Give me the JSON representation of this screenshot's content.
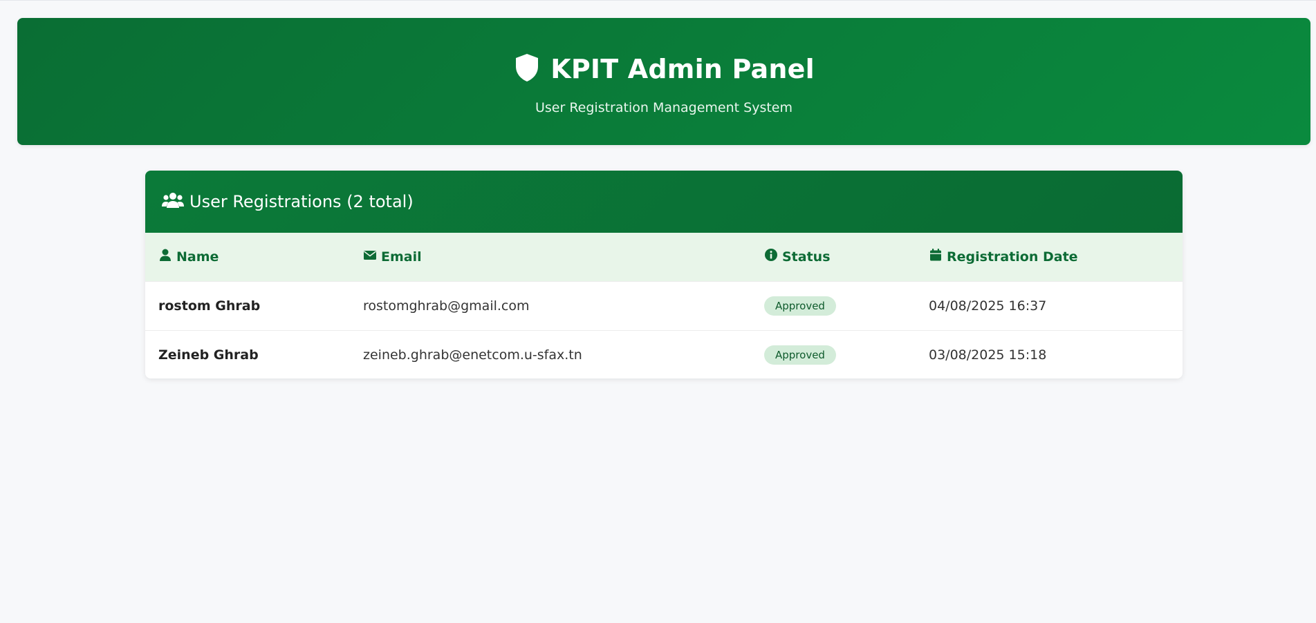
{
  "header": {
    "title": "KPIT Admin Panel",
    "subtitle": "User Registration Management System",
    "icon": "shield-icon"
  },
  "registrations": {
    "title": "User Registrations (2 total)",
    "icon": "users-icon",
    "columns": [
      {
        "label": "Name",
        "icon": "user-icon"
      },
      {
        "label": "Email",
        "icon": "envelope-icon"
      },
      {
        "label": "Status",
        "icon": "info-circle-icon"
      },
      {
        "label": "Registration Date",
        "icon": "calendar-icon"
      }
    ],
    "rows": [
      {
        "name": "rostom Ghrab",
        "email": "rostomghrab@gmail.com",
        "status": "Approved",
        "date": "04/08/2025 16:37"
      },
      {
        "name": "Zeineb Ghrab",
        "email": "zeineb.ghrab@enetcom.u-sfax.tn",
        "status": "Approved",
        "date": "03/08/2025 15:18"
      }
    ]
  },
  "colors": {
    "primary": "#0a7a38",
    "header_row_bg": "#e8f5e9",
    "badge_bg": "#d3ecd9",
    "page_bg": "#f7f8fa"
  }
}
